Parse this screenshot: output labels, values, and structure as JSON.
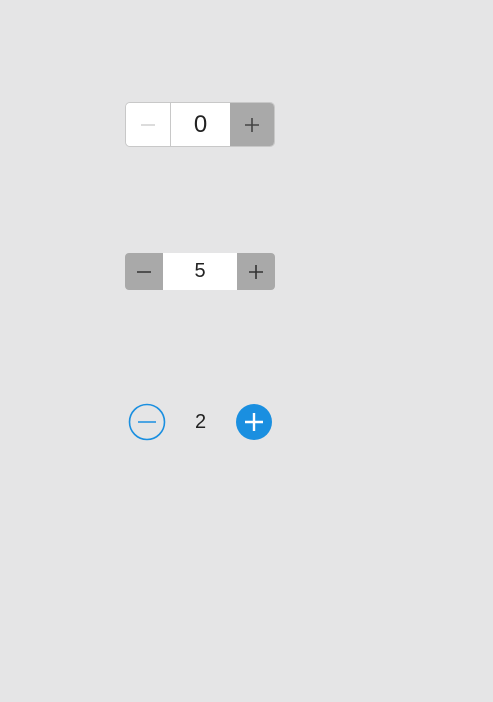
{
  "steppers": [
    {
      "name": "stepper-1",
      "value": "0",
      "minus_icon": "minus-icon",
      "plus_icon": "plus-icon"
    },
    {
      "name": "stepper-2",
      "value": "5",
      "minus_icon": "minus-icon",
      "plus_icon": "plus-icon"
    },
    {
      "name": "stepper-3",
      "value": "2",
      "minus_icon": "circle-minus-icon",
      "plus_icon": "circle-plus-icon"
    }
  ],
  "colors": {
    "background": "#e5e5e6",
    "button_gray": "#a9a9a9",
    "accent_blue": "#1a8fe0"
  }
}
